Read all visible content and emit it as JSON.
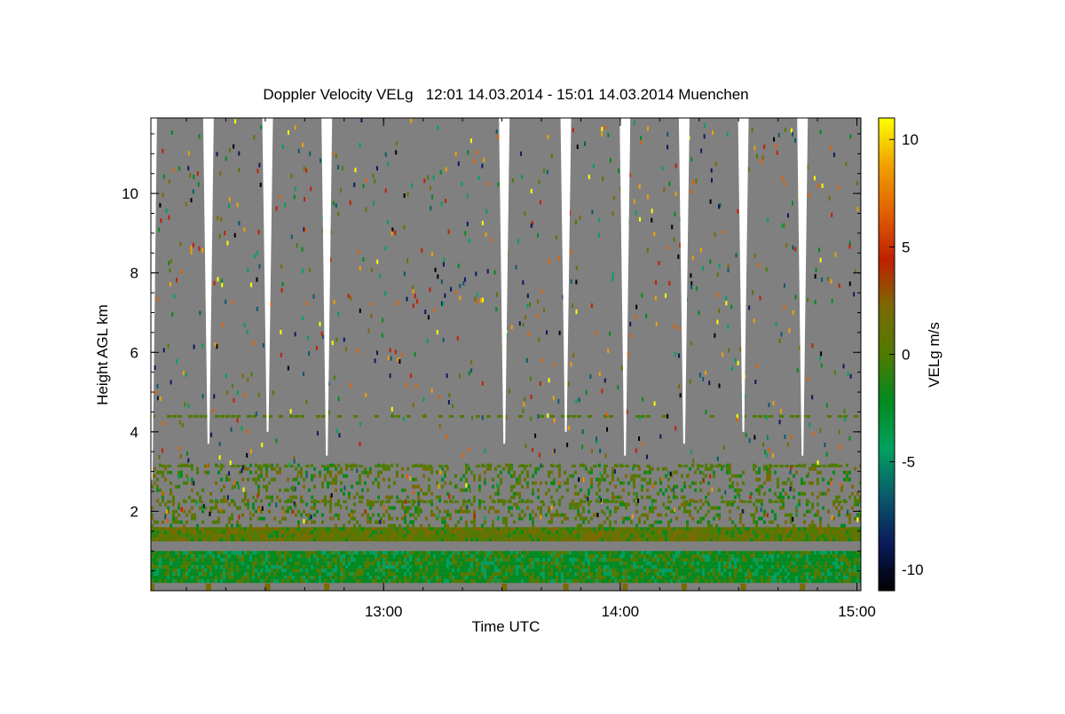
{
  "chart_data": {
    "type": "heatmap",
    "title": "Doppler Velocity VELg   12:01 14.03.2014 - 15:01 14.03.2014 Muenchen",
    "xlabel": "Time UTC",
    "ylabel": "Height AGL km",
    "x_range_hours": [
      12.0167,
      15.0167
    ],
    "x_ticks": [
      {
        "value": 13.0,
        "label": "13:00"
      },
      {
        "value": 14.0,
        "label": "14:00"
      },
      {
        "value": 15.0,
        "label": "15:00"
      }
    ],
    "ylim": [
      0,
      11.9
    ],
    "y_ticks": [
      {
        "value": 2,
        "label": "2"
      },
      {
        "value": 4,
        "label": "4"
      },
      {
        "value": 6,
        "label": "6"
      },
      {
        "value": 8,
        "label": "8"
      },
      {
        "value": 10,
        "label": "10"
      }
    ],
    "colorbar": {
      "label": "VELg m/s",
      "range": [
        -11,
        11
      ],
      "ticks": [
        {
          "value": 10,
          "label": "10"
        },
        {
          "value": 5,
          "label": "5"
        },
        {
          "value": 0,
          "label": "0"
        },
        {
          "value": -5,
          "label": "-5"
        },
        {
          "value": -10,
          "label": "-10"
        }
      ],
      "colors": [
        "#000000",
        "#0a1a5c",
        "#0a5a6a",
        "#00a060",
        "#008a20",
        "#507a00",
        "#7a6a00",
        "#c02000",
        "#e06000",
        "#f0a000",
        "#ffff00"
      ]
    },
    "background_color": "#808080",
    "gap_times_hours": [
      12.26,
      12.51,
      12.76,
      13.51,
      13.77,
      14.02,
      14.27,
      14.52,
      14.77
    ],
    "bands": [
      {
        "name": "low",
        "ymin": 0.2,
        "ymax": 1.0,
        "dominant_velocity": -2
      },
      {
        "name": "upper",
        "ymin": 1.3,
        "ymax": 1.6,
        "dominant_velocity": 0.5
      },
      {
        "name": "sparse",
        "ymin": 1.6,
        "ymax": 3.2,
        "dominant_velocity": 0
      }
    ],
    "layer_heights_km": [
      2.25,
      3.15,
      4.4
    ]
  }
}
